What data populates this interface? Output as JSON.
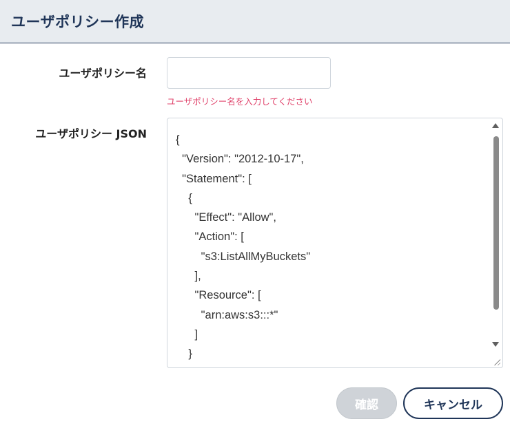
{
  "dialog": {
    "title": "ユーザポリシー作成"
  },
  "form": {
    "name_label": "ユーザポリシー名",
    "name_value": "",
    "name_error": "ユーザポリシー名を入力してください",
    "json_label": "ユーザポリシー JSON",
    "json_value": "{\n  \"Version\": \"2012-10-17\",\n  \"Statement\": [\n    {\n      \"Effect\": \"Allow\",\n      \"Action\": [\n        \"s3:ListAllMyBuckets\"\n      ],\n      \"Resource\": [\n        \"arn:aws:s3:::*\"\n      ]\n    }\n  ]\n}"
  },
  "buttons": {
    "confirm_label": "確認",
    "cancel_label": "キャンセル"
  },
  "colors": {
    "accent": "#1f3558",
    "error": "#e0436b",
    "disabled": "#cfd3d8"
  }
}
